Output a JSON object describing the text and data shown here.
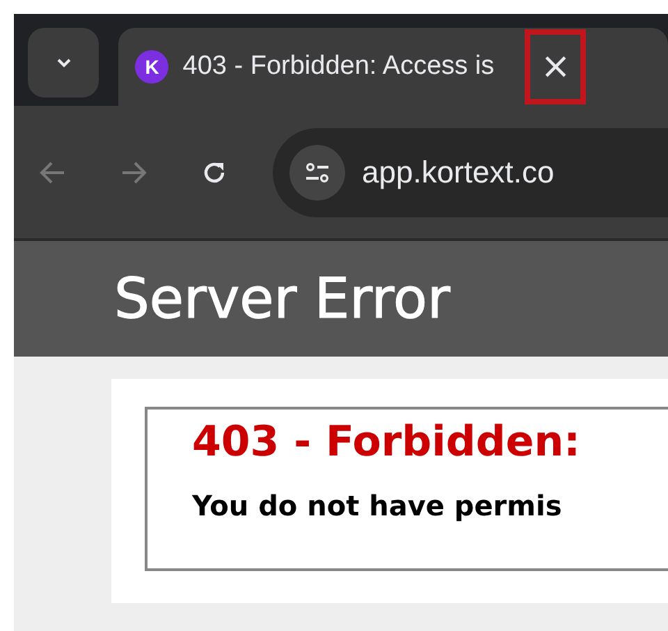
{
  "tab": {
    "favicon_letter": "K",
    "title": "403 - Forbidden: Access is",
    "selected": true,
    "close": "×",
    "close_highlighted": true
  },
  "address_bar": {
    "url": "app.kortext.co"
  },
  "page": {
    "header": "Server Error",
    "error_title": "403 - Forbidden:",
    "error_message": "You do not have permis"
  }
}
